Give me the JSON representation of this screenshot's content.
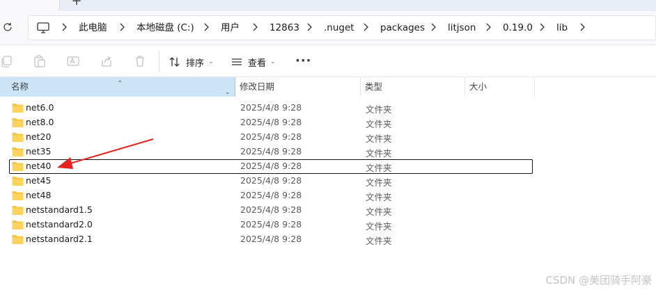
{
  "tabbar": {
    "new_tab": "+"
  },
  "address": {
    "crumbs": [
      "此电脑",
      "本地磁盘 (C:)",
      "用户",
      "12863",
      ".nuget",
      "packages",
      "litjson",
      "0.19.0",
      "lib"
    ]
  },
  "toolbar": {
    "sort_label": "排序",
    "view_label": "查看",
    "more_label": "···"
  },
  "columns": {
    "name": "名称",
    "date": "修改日期",
    "type": "类型",
    "size": "大小"
  },
  "rows": [
    {
      "name": "net6.0",
      "date": "2025/4/8 9:28",
      "type": "文件夹"
    },
    {
      "name": "net8.0",
      "date": "2025/4/8 9:28",
      "type": "文件夹"
    },
    {
      "name": "net20",
      "date": "2025/4/8 9:28",
      "type": "文件夹"
    },
    {
      "name": "net35",
      "date": "2025/4/8 9:28",
      "type": "文件夹"
    },
    {
      "name": "net40",
      "date": "2025/4/8 9:28",
      "type": "文件夹"
    },
    {
      "name": "net45",
      "date": "2025/4/8 9:28",
      "type": "文件夹"
    },
    {
      "name": "net48",
      "date": "2025/4/8 9:28",
      "type": "文件夹"
    },
    {
      "name": "netstandard1.5",
      "date": "2025/4/8 9:28",
      "type": "文件夹"
    },
    {
      "name": "netstandard2.0",
      "date": "2025/4/8 9:28",
      "type": "文件夹"
    },
    {
      "name": "netstandard2.1",
      "date": "2025/4/8 9:28",
      "type": "文件夹"
    }
  ],
  "colors": {
    "header_selected": "#cce4f7",
    "folder": "#f8c443",
    "annotation": "#e8231f"
  },
  "watermark": "CSDN @美团骑手阿豪"
}
